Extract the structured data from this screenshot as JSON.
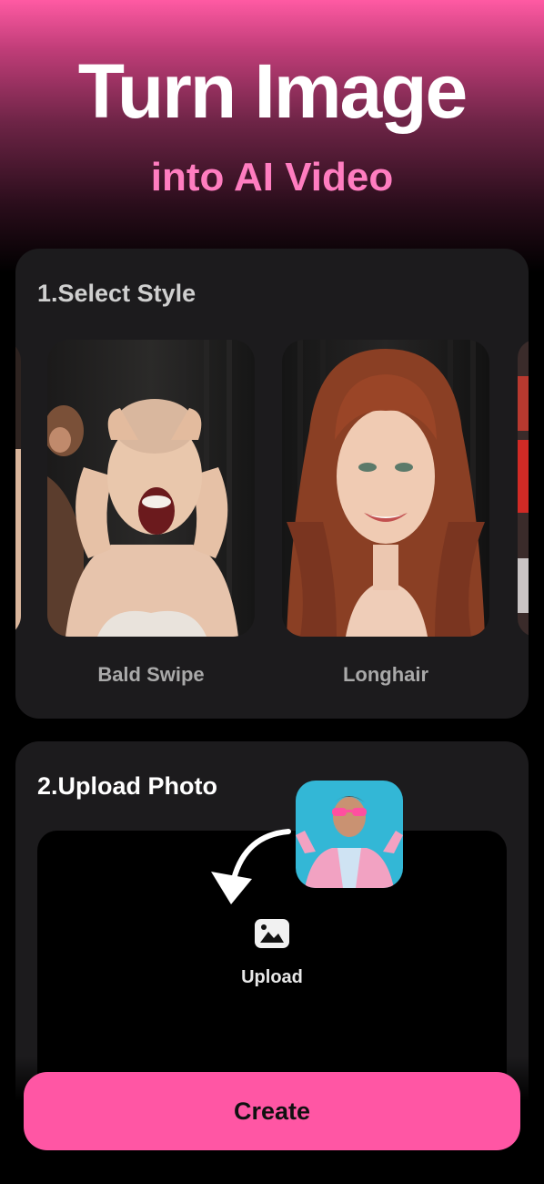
{
  "header": {
    "title": "Turn Image",
    "subtitle": "into AI Video"
  },
  "style_section": {
    "title": "1.Select Style",
    "items": [
      {
        "label": "Bald Swipe"
      },
      {
        "label": "Longhair"
      }
    ]
  },
  "upload_section": {
    "title": "2.Upload Photo",
    "upload_label": "Upload",
    "icon": "image-icon"
  },
  "actions": {
    "create_label": "Create"
  },
  "colors": {
    "accent": "#ff56a4",
    "subtitle": "#ff7dc0",
    "card": "#1c1b1d"
  }
}
